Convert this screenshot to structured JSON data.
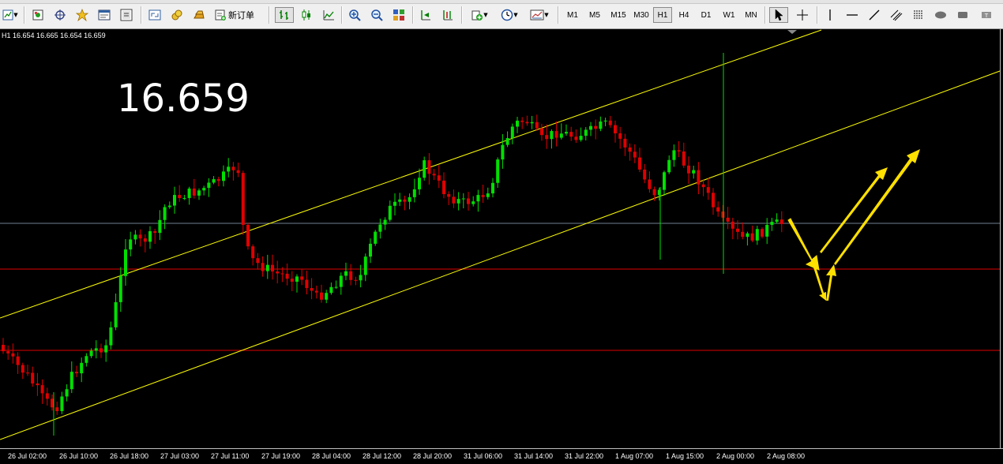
{
  "toolbar": {
    "new_order_label": "新订单",
    "timeframes": [
      "M1",
      "M5",
      "M15",
      "M30",
      "H1",
      "H4",
      "D1",
      "W1",
      "MN"
    ],
    "active_timeframe": "H1"
  },
  "chart": {
    "symbol_period": "H1",
    "ohlc_text": "16.654 16.665 16.654 16.659",
    "big_price": "16.659",
    "time_labels": [
      "26 Jul 02:00",
      "26 Jul 10:00",
      "26 Jul 18:00",
      "27 Jul 03:00",
      "27 Jul 11:00",
      "27 Jul 19:00",
      "28 Jul 04:00",
      "28 Jul 12:00",
      "28 Jul 20:00",
      "31 Jul 06:00",
      "31 Jul 14:00",
      "31 Jul 22:00",
      "1 Aug 07:00",
      "1 Aug 15:00",
      "2 Aug 00:00",
      "2 Aug 08:00"
    ],
    "colors": {
      "background": "#000000",
      "bull": "#00e000",
      "bear": "#e00000",
      "channel": "#ffff00",
      "support": "#ff0000",
      "bid_line": "#708090",
      "arrows": "#ffe000"
    }
  }
}
